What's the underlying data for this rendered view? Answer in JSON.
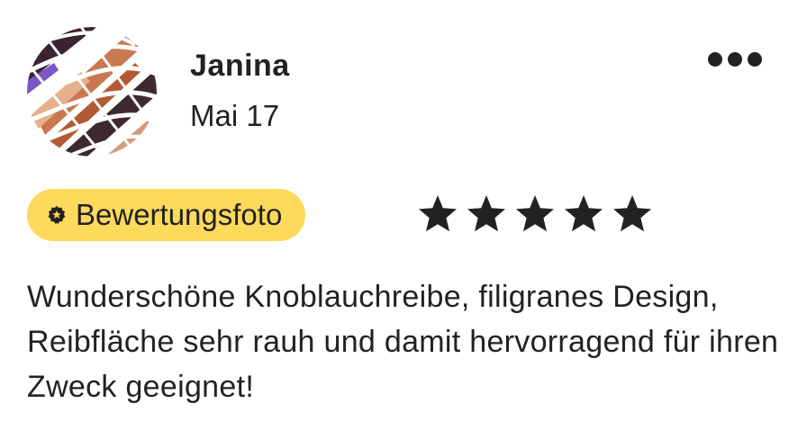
{
  "review": {
    "reviewer_name": "Janina",
    "date": "Mai 17",
    "badge_label": "Bewertungsfoto",
    "rating": 5,
    "rating_max": 5,
    "text": "Wunderschöne Knoblauchreibe, filigranes Design, Reibfläche sehr rauh und damit hervorragend für ihren Zweck geeignet!"
  },
  "icons": {
    "more": "more-options-icon",
    "badge": "star-seal-icon",
    "star": "star-icon"
  },
  "colors": {
    "badge_background": "#fdd95c",
    "text": "#222222",
    "star": "#222222"
  }
}
